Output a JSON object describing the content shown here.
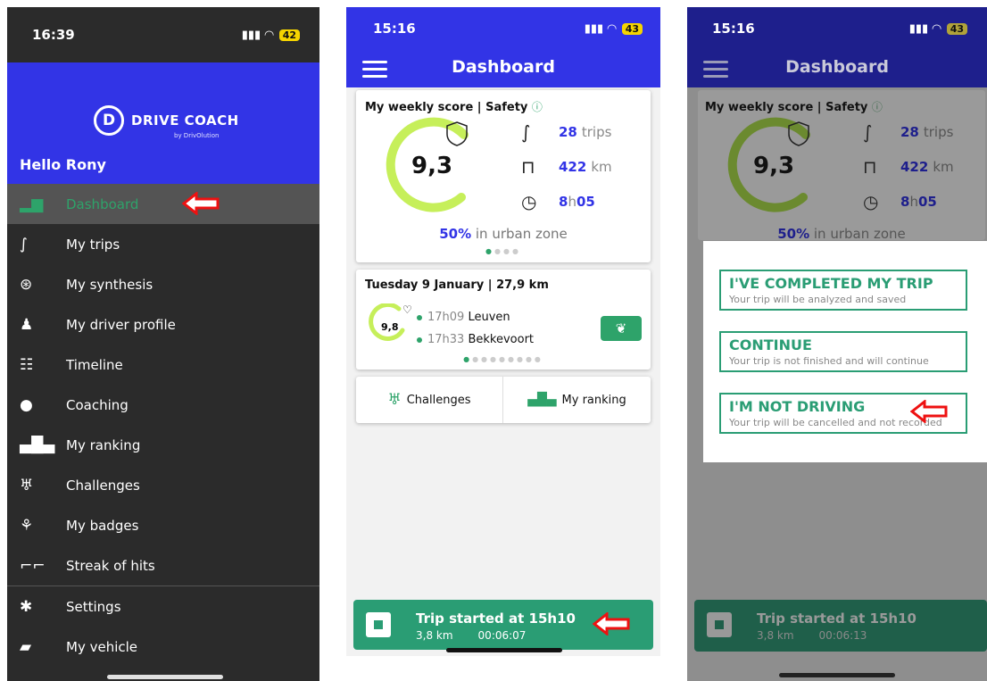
{
  "colors": {
    "brand_blue": "#3234e6",
    "accent_green": "#2ea36a",
    "banner_green": "#2a9d74",
    "arrow_red": "#e11"
  },
  "phone1": {
    "status": {
      "time": "16:39",
      "battery": "42"
    },
    "logo": {
      "letter": "D",
      "name": "DRIVE COACH",
      "by": "by DrivOlution"
    },
    "greeting": "Hello Rony",
    "menu": [
      {
        "label": "Dashboard",
        "icon": "bar-chart-icon",
        "active": true
      },
      {
        "label": "My trips",
        "icon": "route-icon"
      },
      {
        "label": "My synthesis",
        "icon": "steering-wheel-icon"
      },
      {
        "label": "My driver profile",
        "icon": "driver-icon"
      },
      {
        "label": "Timeline",
        "icon": "timeline-icon"
      },
      {
        "label": "Coaching",
        "icon": "chat-bubble-icon"
      },
      {
        "label": "My ranking",
        "icon": "podium-icon"
      },
      {
        "label": "Challenges",
        "icon": "trophy-icon"
      },
      {
        "label": "My badges",
        "icon": "badge-icon"
      },
      {
        "label": "Streak of hits",
        "icon": "stairs-icon"
      },
      {
        "label": "Settings",
        "icon": "gear-icon"
      },
      {
        "label": "My vehicle",
        "icon": "car-icon"
      }
    ]
  },
  "phone2": {
    "status": {
      "time": "15:16",
      "battery": "43"
    },
    "title": "Dashboard",
    "weekly": {
      "title": "My weekly score | Safety",
      "score": "9,3",
      "trips_value": "28",
      "trips_unit": "trips",
      "km_value": "422",
      "km_unit": "km",
      "time_h": "8",
      "time_sep": "h",
      "time_m": "05",
      "urban_value": "50%",
      "urban_text": "in urban zone"
    },
    "trip": {
      "title": "Tuesday 9 January | 27,9 km",
      "score": "9,8",
      "start_time": "17h09",
      "start_place": "Leuven",
      "end_time": "17h33",
      "end_place": "Bekkevoort"
    },
    "links": {
      "challenges": "Challenges",
      "ranking": "My ranking"
    },
    "banner": {
      "title": "Trip started at 15h10",
      "km": "3,8 km",
      "duration": "00:06:07"
    }
  },
  "phone3": {
    "status": {
      "time": "15:16",
      "battery": "43"
    },
    "title": "Dashboard",
    "weekly": {
      "title": "My weekly score | Safety",
      "score": "9,3",
      "trips_value": "28",
      "trips_unit": "trips",
      "km_value": "422",
      "km_unit": "km",
      "time_h": "8",
      "time_sep": "h",
      "time_m": "05",
      "urban_value": "50%",
      "urban_text": "in urban zone"
    },
    "options": [
      {
        "title": "I'VE COMPLETED MY TRIP",
        "subtitle": "Your trip will be analyzed and saved"
      },
      {
        "title": "CONTINUE",
        "subtitle": "Your trip is not finished and will continue"
      },
      {
        "title": "I'M NOT DRIVING",
        "subtitle": "Your trip will be cancelled and not recorded"
      }
    ],
    "banner": {
      "title": "Trip started at 15h10",
      "km": "3,8 km",
      "duration": "00:06:13"
    }
  }
}
